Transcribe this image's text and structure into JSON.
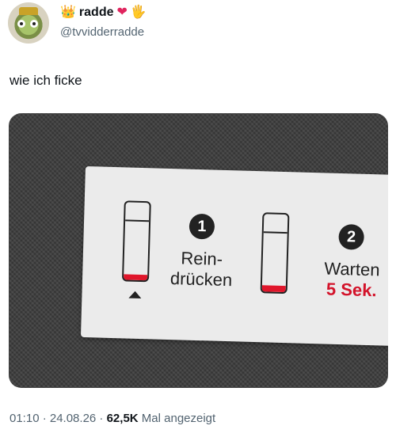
{
  "author": {
    "display_name": "radde",
    "handle": "@tvvidderradde",
    "name_emojis": [
      "crown-icon",
      "red-heart-icon",
      "waving-hand-icon"
    ]
  },
  "tweet": {
    "text": "wie ich ficke"
  },
  "photo": {
    "step1_number": "1",
    "step1_line1": "Rein-",
    "step1_line2": "drücken",
    "step2_number": "2",
    "step2_line1": "Warten",
    "step2_line2": "5 Sek.",
    "accent_color": "#e0162b"
  },
  "meta": {
    "time_date": "01:10 · 24.08.26 · ",
    "views": "62,5K",
    "views_label": " Mal angezeigt"
  }
}
